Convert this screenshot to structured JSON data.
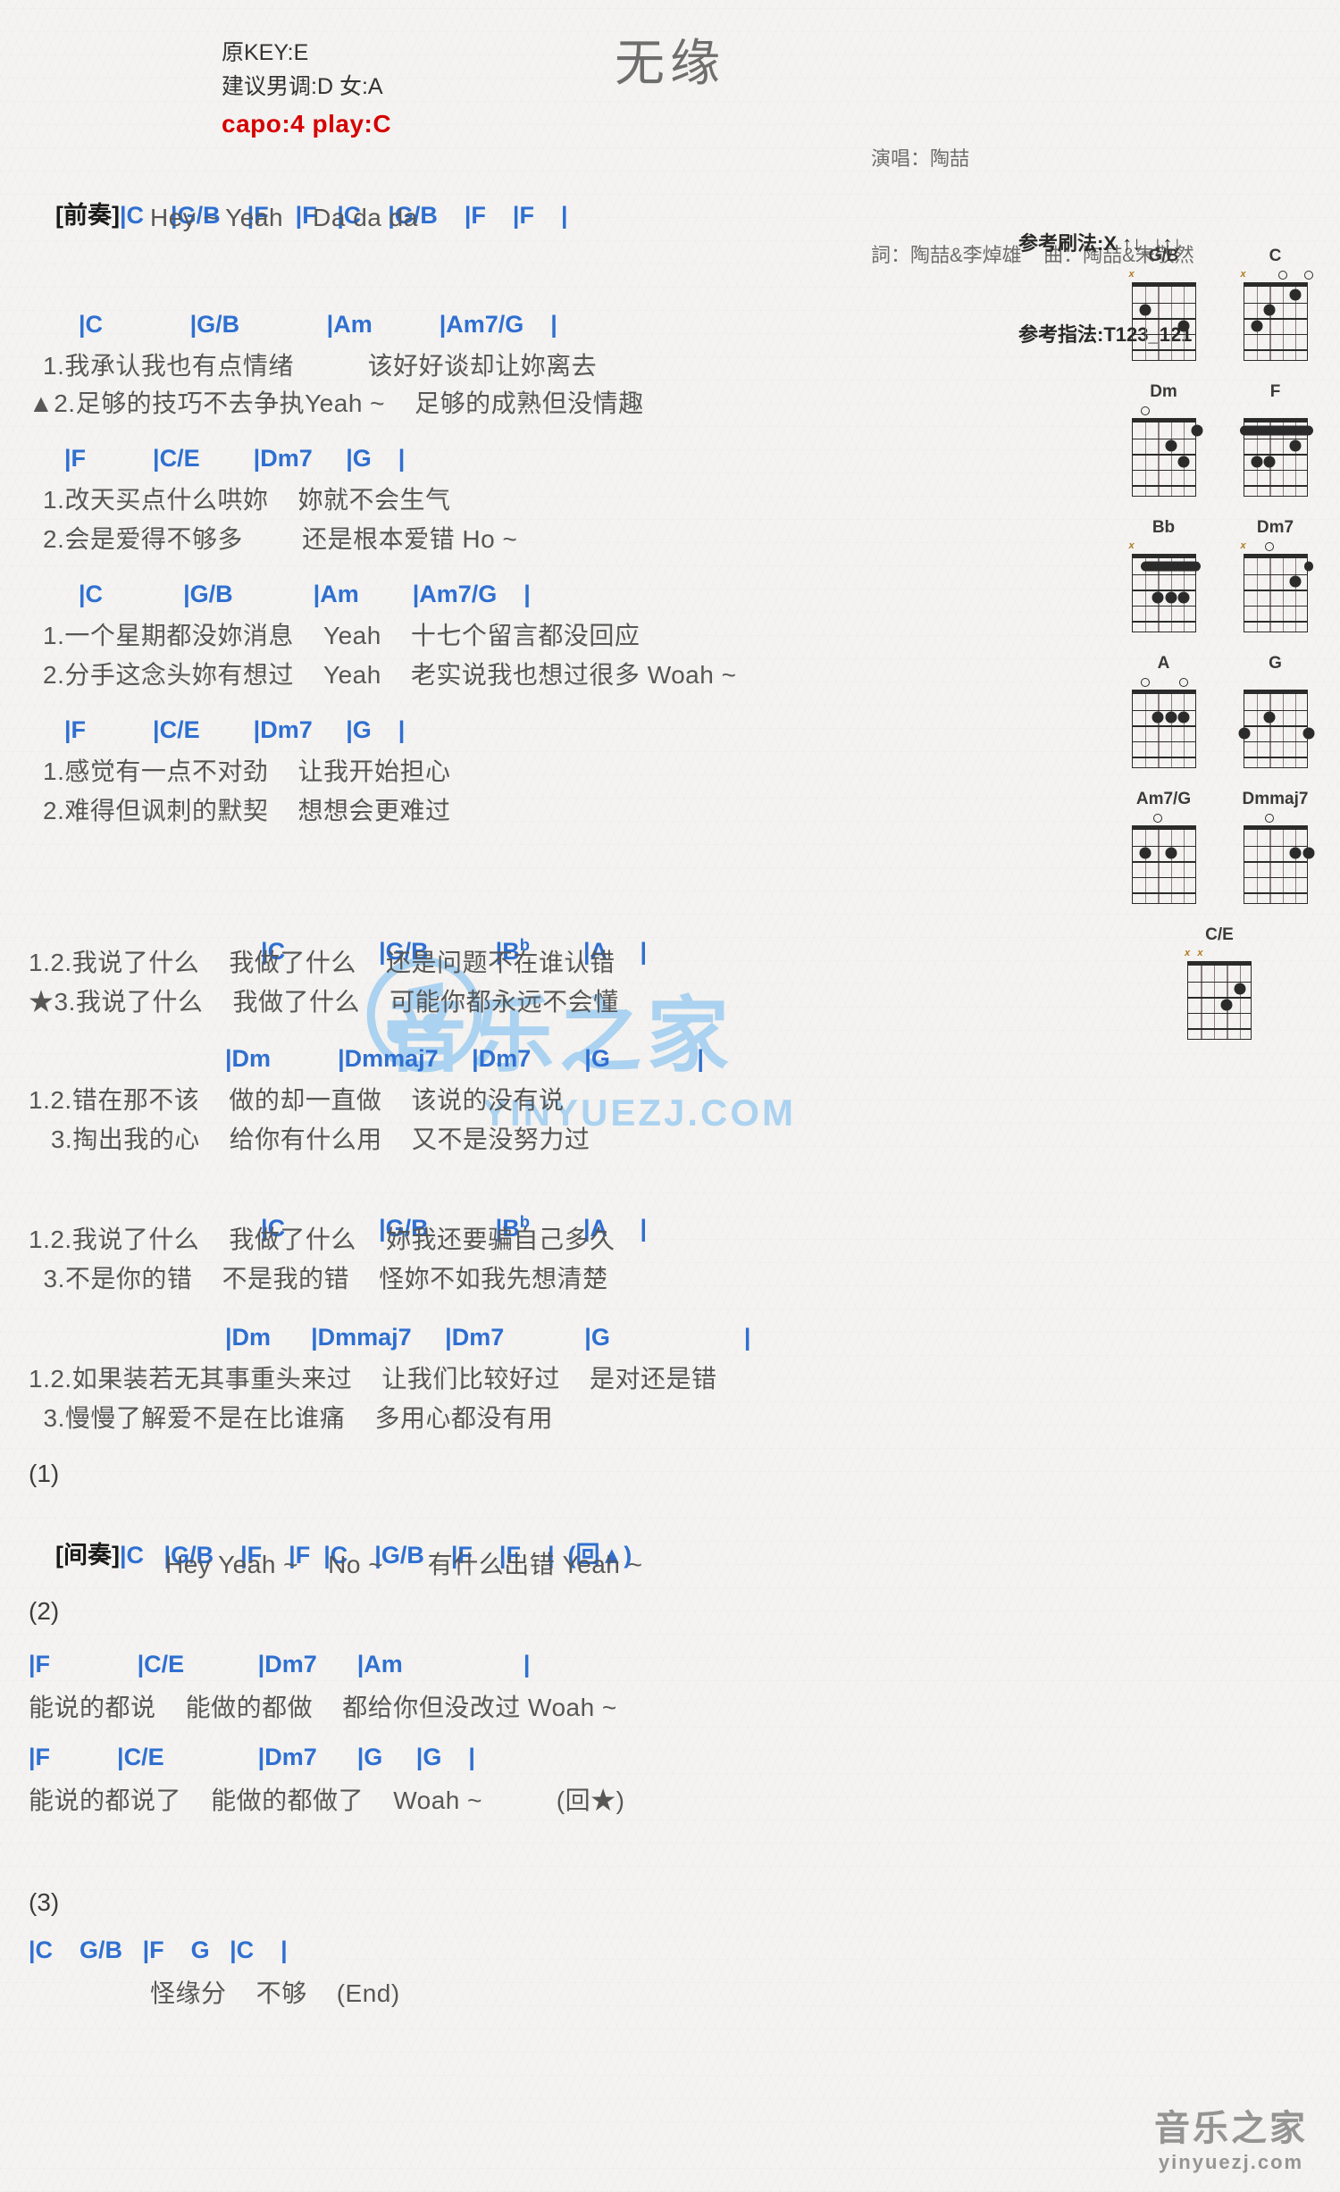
{
  "header": {
    "orig_key": "原KEY:E",
    "suggest_key": "建议男调:D 女:A",
    "capo": "capo:4 play:C",
    "title": "无缘",
    "singer": "演唱：陶喆",
    "writers": "詞：陶喆&李焯雄    曲：陶喆&朱敬然",
    "strum": "参考刷法:X ↑↓_↓↑↓",
    "fingerstyle": "参考指法:T123_121"
  },
  "sections": {
    "intro_label": "[前奏]",
    "intro_chords": "|C    |G/B    |F    |F   |C    |G/B    |F    |F    |",
    "intro_lyric": "Hey ~ Yeah    Da da da",
    "v1_chords": "|C             |G/B             |Am          |Am7/G    |",
    "v1_line1": "1.我承认我也有点情绪          该好好谈却让妳离去",
    "v1_line2": "▲2.足够的技巧不去争执Yeah ~    足够的成熟但没情趣",
    "v2_chords": "|F          |C/E        |Dm7     |G    |",
    "v2_line1": "1.改天买点什么哄妳    妳就不会生气",
    "v2_line2": "2.会是爱得不够多        还是根本爱错 Ho ~",
    "v3_chords": "|C            |G/B            |Am        |Am7/G    |",
    "v3_line1": "1.一个星期都没妳消息    Yeah    十七个留言都没回应",
    "v3_line2": "2.分手这念头妳有想过    Yeah    老实说我也想过很多 Woah ~",
    "v4_chords": "|F          |C/E        |Dm7     |G    |",
    "v4_line1": "1.感觉有一点不对劲    让我开始担心",
    "v4_line2": "2.难得但讽刺的默契    想想会更难过",
    "c1_chords_pre": "|C              |G/B          |B",
    "c1_chords_flat": "b",
    "c1_chords_post": "        |A     |",
    "c1_line1": "1.2.我说了什么    我做了什么    还是问题不在谁认错",
    "c1_line2": "★3.我说了什么    我做了什么    可能你都永远不会懂",
    "c2_chords": "|Dm          |Dmmaj7     |Dm7        |G             |",
    "c2_line1": "1.2.错在那不该    做的却一直做    该说的没有说",
    "c2_line2": "   3.掏出我的心    给你有什么用    又不是没努力过",
    "c3_line1": "1.2.我说了什么    我做了什么    妳我还要骗自己多久",
    "c3_line2": "  3.不是你的错    不是我的错    怪妳不如我先想清楚",
    "c4_chords": "|Dm      |Dmmaj7     |Dm7            |G                    |",
    "c4_line1": "1.2.如果装若无其事重头来过    让我们比较好过    是对还是错",
    "c4_line2": "  3.慢慢了解爱不是在比谁痛    多用心都没有用",
    "mark1": "(1)",
    "interlude_label": "[间奏]",
    "interlude_chords": "|C   |G/B    |F    |F  |C    |G/B    |F    |F    |  (回▲)",
    "interlude_lyric": "Hey Yeah ~    No ~      有什么出错 Yeah ~",
    "mark2": "(2)",
    "b1_chords": "|F             |C/E           |Dm7      |Am                  |",
    "b1_lyric": "能说的都说    能做的都做    都给你但没改过 Woah ~",
    "b2_chords": "|F          |C/E              |Dm7      |G     |G    |",
    "b2_lyric": "能说的都说了    能做的都做了    Woah ~          (回★)",
    "mark3": "(3)",
    "end_chords": "|C    G/B   |F    G   |C    |",
    "end_lyric": "怪缘分    不够    (End)"
  },
  "chords": [
    {
      "name": "G/B",
      "markers": [
        {
          "type": "x",
          "string": 1
        }
      ],
      "nut": true,
      "dots": [
        {
          "string": 2,
          "fret": 2
        },
        {
          "string": 5,
          "fret": 3
        }
      ],
      "barres": []
    },
    {
      "name": "C",
      "markers": [
        {
          "type": "x",
          "string": 1
        },
        {
          "type": "o",
          "string": 4
        },
        {
          "type": "o",
          "string": 6
        }
      ],
      "nut": true,
      "dots": [
        {
          "string": 5,
          "fret": 1
        },
        {
          "string": 3,
          "fret": 2
        },
        {
          "string": 2,
          "fret": 3
        }
      ],
      "barres": []
    },
    {
      "name": "Dm",
      "markers": [
        {
          "type": "o",
          "string": 2
        }
      ],
      "nut": true,
      "dots": [
        {
          "string": 6,
          "fret": 1
        },
        {
          "string": 4,
          "fret": 2
        },
        {
          "string": 5,
          "fret": 3
        }
      ],
      "barres": []
    },
    {
      "name": "F",
      "markers": [],
      "nut": true,
      "dots": [
        {
          "string": 5,
          "fret": 2
        },
        {
          "string": 2,
          "fret": 3
        },
        {
          "string": 3,
          "fret": 3
        }
      ],
      "barres": [
        {
          "fret": 1,
          "from": 1,
          "to": 6
        }
      ]
    },
    {
      "name": "Bb",
      "markers": [
        {
          "type": "x",
          "string": 1
        }
      ],
      "nut": true,
      "dots": [
        {
          "string": 3,
          "fret": 3
        },
        {
          "string": 4,
          "fret": 3
        },
        {
          "string": 5,
          "fret": 3
        }
      ],
      "barres": [
        {
          "fret": 1,
          "from": 2,
          "to": 6
        }
      ]
    },
    {
      "name": "Dm7",
      "markers": [
        {
          "type": "x",
          "string": 1
        },
        {
          "type": "o",
          "string": 3
        }
      ],
      "nut": true,
      "dots": [
        {
          "string": 5,
          "fret": 2
        }
      ],
      "barres": [
        {
          "fret": 1,
          "from": 6,
          "to": 6
        }
      ]
    },
    {
      "name": "A",
      "markers": [
        {
          "type": "o",
          "string": 2
        },
        {
          "type": "o",
          "string": 5
        }
      ],
      "nut": true,
      "dots": [
        {
          "string": 3,
          "fret": 2
        },
        {
          "string": 4,
          "fret": 2
        },
        {
          "string": 5,
          "fret": 2
        }
      ],
      "barres": []
    },
    {
      "name": "G",
      "markers": [],
      "nut": true,
      "dots": [
        {
          "string": 3,
          "fret": 2
        },
        {
          "string": 1,
          "fret": 3
        },
        {
          "string": 6,
          "fret": 3
        }
      ],
      "barres": []
    },
    {
      "name": "Am7/G",
      "markers": [
        {
          "type": "o",
          "string": 3
        }
      ],
      "nut": true,
      "dots": [
        {
          "string": 2,
          "fret": 2
        },
        {
          "string": 4,
          "fret": 2
        }
      ],
      "barres": []
    },
    {
      "name": "Dmmaj7",
      "markers": [
        {
          "type": "o",
          "string": 3
        }
      ],
      "nut": true,
      "dots": [
        {
          "string": 5,
          "fret": 2
        },
        {
          "string": 6,
          "fret": 2
        }
      ],
      "barres": []
    },
    {
      "name": "C/E",
      "markers": [
        {
          "type": "x",
          "string": 1
        },
        {
          "type": "x",
          "string": 2
        }
      ],
      "nut": true,
      "dots": [
        {
          "string": 5,
          "fret": 2
        },
        {
          "string": 4,
          "fret": 3
        }
      ],
      "barres": []
    }
  ],
  "watermark": {
    "center_main": "音乐之家",
    "center_sub": "YINYUEZJ.COM",
    "bottom_main": "音乐之家",
    "bottom_sub": "yinyuezj.com"
  },
  "colors": {
    "chord": "#2f6fd0",
    "bar": "#b07a20",
    "capo": "#d60000",
    "lyric": "#575757",
    "paper": "#f4f3f1",
    "watermark": "#9fcdf0"
  }
}
